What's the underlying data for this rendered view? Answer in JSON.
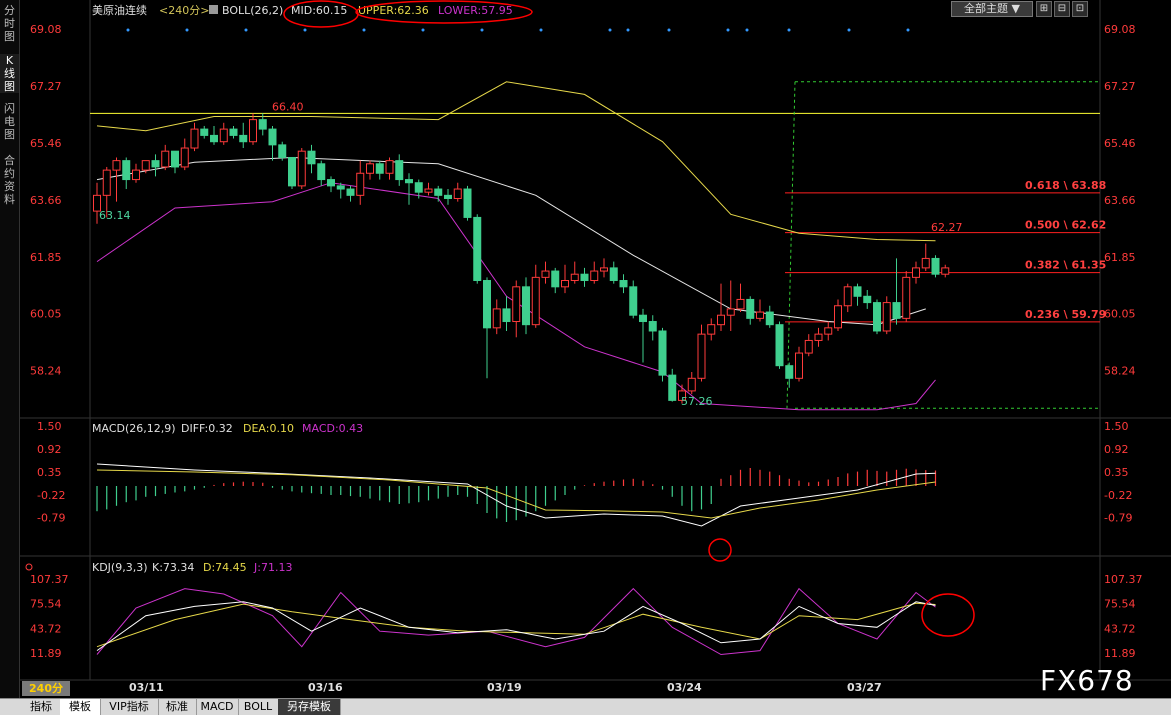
{
  "sidebar": {
    "tabs": [
      {
        "label": "分时图",
        "active": false
      },
      {
        "label": "K线图",
        "active": true
      },
      {
        "label": "闪电图",
        "active": false
      },
      {
        "label": "合约资料",
        "active": false
      }
    ]
  },
  "header": {
    "symbol": "美原油连续",
    "period": "<240分>",
    "boll_label": "BOLL(26,2)",
    "mid": "MID:60.15",
    "upper": "UPPER:62.36",
    "lower": "LOWER:57.95",
    "theme": "全部主题",
    "theme_icon": "dropdown-arrow-icon"
  },
  "price_axis": [
    "69.08",
    "67.27",
    "65.46",
    "63.66",
    "61.85",
    "60.05",
    "58.24"
  ],
  "annotations": {
    "level_line": "66.40",
    "low_left": "63.14",
    "low_mid": "57.26",
    "high_right": "62.27"
  },
  "fibonacci": [
    {
      "label": "0.618 \\ 63.88",
      "value": 63.88
    },
    {
      "label": "0.500 \\ 62.62",
      "value": 62.62
    },
    {
      "label": "0.382 \\ 61.35",
      "value": 61.35
    },
    {
      "label": "0.236 \\ 59.79",
      "value": 59.79
    }
  ],
  "macd": {
    "label": "MACD(26,12,9)",
    "diff": "DIFF:0.32",
    "dea": "DEA:0.10",
    "value": "MACD:0.43",
    "axis": [
      "1.50",
      "0.92",
      "0.35",
      "-0.22",
      "-0.79"
    ]
  },
  "kdj": {
    "label": "KDJ(9,3,3)",
    "k": "K:73.34",
    "d": "D:74.45",
    "j": "J:71.13",
    "axis": [
      "107.37",
      "75.54",
      "43.72",
      "11.89"
    ]
  },
  "x_axis": [
    "03/11",
    "03/16",
    "03/19",
    "03/24",
    "03/27"
  ],
  "period_badge": "240分",
  "bottom_tabs": [
    "指标",
    "模板",
    "VIP指标",
    "标准",
    "MACD",
    "BOLL",
    "另存模板"
  ],
  "watermark": "FX678",
  "colors": {
    "up": "#ff3b3b",
    "down": "#3fcf8e",
    "boll_mid": "#e6e6e6",
    "boll_upper": "#e6d84a",
    "boll_lower": "#cc33cc",
    "fib": "#ff2020",
    "highlight": "#ff0000"
  },
  "chart_data": {
    "type": "candlestick",
    "candles": [
      [
        63.3,
        63.8,
        64.2,
        62.9
      ],
      [
        63.8,
        64.6,
        64.7,
        63.1
      ],
      [
        64.6,
        64.9,
        65.0,
        63.6
      ],
      [
        64.9,
        64.3,
        65.0,
        64.0
      ],
      [
        64.3,
        64.6,
        64.8,
        64.2
      ],
      [
        64.6,
        64.9,
        64.9,
        64.5
      ],
      [
        64.9,
        64.7,
        65.1,
        64.4
      ],
      [
        64.7,
        65.2,
        65.4,
        64.6
      ],
      [
        65.2,
        64.7,
        65.2,
        64.5
      ],
      [
        64.7,
        65.3,
        65.6,
        64.6
      ],
      [
        65.3,
        65.9,
        66.1,
        65.2
      ],
      [
        65.9,
        65.7,
        66.0,
        65.6
      ],
      [
        65.7,
        65.5,
        66.0,
        65.4
      ],
      [
        65.5,
        65.9,
        66.1,
        65.4
      ],
      [
        65.9,
        65.7,
        66.0,
        65.6
      ],
      [
        65.7,
        65.5,
        66.1,
        65.3
      ],
      [
        65.5,
        66.2,
        66.4,
        65.4
      ],
      [
        66.2,
        65.9,
        66.4,
        65.7
      ],
      [
        65.9,
        65.4,
        66.0,
        64.9
      ],
      [
        65.4,
        65.0,
        65.5,
        64.9
      ],
      [
        65.0,
        64.1,
        65.0,
        64.0
      ],
      [
        64.1,
        65.2,
        65.3,
        64.0
      ],
      [
        65.2,
        64.8,
        65.4,
        64.5
      ],
      [
        64.8,
        64.3,
        64.9,
        64.1
      ],
      [
        64.3,
        64.1,
        64.4,
        63.9
      ],
      [
        64.1,
        64.0,
        64.2,
        63.7
      ],
      [
        64.0,
        63.8,
        64.1,
        63.6
      ],
      [
        63.8,
        64.5,
        64.9,
        63.5
      ],
      [
        64.5,
        64.8,
        64.9,
        64.3
      ],
      [
        64.8,
        64.5,
        64.9,
        64.3
      ],
      [
        64.5,
        64.9,
        65.0,
        64.3
      ],
      [
        64.9,
        64.3,
        65.1,
        64.1
      ],
      [
        64.3,
        64.2,
        64.5,
        63.5
      ],
      [
        64.2,
        63.9,
        64.3,
        63.7
      ],
      [
        63.9,
        64.0,
        64.2,
        63.8
      ],
      [
        64.0,
        63.8,
        64.1,
        63.6
      ],
      [
        63.8,
        63.7,
        64.0,
        63.5
      ],
      [
        63.7,
        64.0,
        64.2,
        63.6
      ],
      [
        64.0,
        63.1,
        64.1,
        63.0
      ],
      [
        63.1,
        61.1,
        63.2,
        61.0
      ],
      [
        61.1,
        59.6,
        61.2,
        58.0
      ],
      [
        59.6,
        60.2,
        60.5,
        59.4
      ],
      [
        60.2,
        59.8,
        60.6,
        59.5
      ],
      [
        59.8,
        60.9,
        61.1,
        59.3
      ],
      [
        60.9,
        59.7,
        61.2,
        59.4
      ],
      [
        59.7,
        61.2,
        61.6,
        59.6
      ],
      [
        61.2,
        61.4,
        61.7,
        61.0
      ],
      [
        61.4,
        60.9,
        61.5,
        60.7
      ],
      [
        60.9,
        61.1,
        61.6,
        60.7
      ],
      [
        61.1,
        61.3,
        61.7,
        61.0
      ],
      [
        61.3,
        61.1,
        61.5,
        60.9
      ],
      [
        61.1,
        61.4,
        61.7,
        61.0
      ],
      [
        61.4,
        61.5,
        61.8,
        61.2
      ],
      [
        61.5,
        61.1,
        61.7,
        61.0
      ],
      [
        61.1,
        60.9,
        61.3,
        60.7
      ],
      [
        60.9,
        60.0,
        61.1,
        59.9
      ],
      [
        60.0,
        59.8,
        60.2,
        58.5
      ],
      [
        59.8,
        59.5,
        60.0,
        59.2
      ],
      [
        59.5,
        58.1,
        59.6,
        57.9
      ],
      [
        58.1,
        57.3,
        58.3,
        57.26
      ],
      [
        57.3,
        57.6,
        57.8,
        57.2
      ],
      [
        57.6,
        58.0,
        58.2,
        57.5
      ],
      [
        58.0,
        59.4,
        59.7,
        57.9
      ],
      [
        59.4,
        59.7,
        59.9,
        59.2
      ],
      [
        59.7,
        60.0,
        61.0,
        59.5
      ],
      [
        60.0,
        60.2,
        61.1,
        59.5
      ],
      [
        60.2,
        60.5,
        61.0,
        60.1
      ],
      [
        60.5,
        59.9,
        60.6,
        59.7
      ],
      [
        59.9,
        60.1,
        60.5,
        59.8
      ],
      [
        60.1,
        59.7,
        60.3,
        59.6
      ],
      [
        59.7,
        58.4,
        59.8,
        58.3
      ],
      [
        58.4,
        58.0,
        58.5,
        57.7
      ],
      [
        58.0,
        58.8,
        59.0,
        57.9
      ],
      [
        58.8,
        59.2,
        59.4,
        58.7
      ],
      [
        59.2,
        59.4,
        59.6,
        59.0
      ],
      [
        59.4,
        59.6,
        59.8,
        59.2
      ],
      [
        59.6,
        60.3,
        60.5,
        59.5
      ],
      [
        60.3,
        60.9,
        61.0,
        60.1
      ],
      [
        60.9,
        60.6,
        61.0,
        60.3
      ],
      [
        60.6,
        60.4,
        60.8,
        60.2
      ],
      [
        60.4,
        59.5,
        60.5,
        59.4
      ],
      [
        59.5,
        60.4,
        60.6,
        59.4
      ],
      [
        60.4,
        59.9,
        61.8,
        59.7
      ],
      [
        59.9,
        61.2,
        61.4,
        59.8
      ],
      [
        61.2,
        61.5,
        61.7,
        61.0
      ],
      [
        61.5,
        61.8,
        62.27,
        61.4
      ],
      [
        61.8,
        61.3,
        61.9,
        61.2
      ],
      [
        61.3,
        61.5,
        61.6,
        61.2
      ]
    ],
    "boll_mid": [
      [
        0,
        64.3
      ],
      [
        10,
        64.85
      ],
      [
        20,
        65.0
      ],
      [
        35,
        64.8
      ],
      [
        45,
        63.8
      ],
      [
        55,
        61.9
      ],
      [
        65,
        60.2
      ],
      [
        75,
        59.8
      ],
      [
        80,
        59.7
      ],
      [
        85,
        60.2
      ]
    ],
    "boll_upper": [
      [
        0,
        66.0
      ],
      [
        5,
        65.85
      ],
      [
        12,
        66.3
      ],
      [
        22,
        66.3
      ],
      [
        35,
        66.2
      ],
      [
        42,
        67.4
      ],
      [
        50,
        67.0
      ],
      [
        58,
        65.5
      ],
      [
        65,
        63.2
      ],
      [
        72,
        62.6
      ],
      [
        80,
        62.4
      ],
      [
        86,
        62.36
      ]
    ],
    "boll_lower": [
      [
        0,
        61.7
      ],
      [
        8,
        63.4
      ],
      [
        18,
        63.6
      ],
      [
        24,
        64.2
      ],
      [
        35,
        63.7
      ],
      [
        42,
        60.6
      ],
      [
        50,
        59.0
      ],
      [
        58,
        58.2
      ],
      [
        62,
        57.2
      ],
      [
        72,
        57.0
      ],
      [
        80,
        57.0
      ],
      [
        84,
        57.2
      ],
      [
        86,
        57.95
      ]
    ],
    "macd_hist": [
      -0.7,
      -0.65,
      -0.55,
      -0.45,
      -0.4,
      -0.3,
      -0.28,
      -0.22,
      -0.18,
      -0.15,
      -0.1,
      -0.05,
      0.03,
      0.08,
      0.1,
      0.12,
      0.11,
      0.09,
      -0.05,
      -0.1,
      -0.15,
      -0.18,
      -0.2,
      -0.22,
      -0.25,
      -0.25,
      -0.28,
      -0.3,
      -0.35,
      -0.4,
      -0.45,
      -0.5,
      -0.48,
      -0.45,
      -0.4,
      -0.35,
      -0.3,
      -0.25,
      -0.3,
      -0.5,
      -0.75,
      -0.9,
      -1.0,
      -0.95,
      -0.85,
      -0.7,
      -0.55,
      -0.4,
      -0.25,
      -0.1,
      0.02,
      0.08,
      0.12,
      0.15,
      0.18,
      0.2,
      0.15,
      0.05,
      -0.1,
      -0.3,
      -0.55,
      -0.7,
      -0.65,
      -0.5,
      0.2,
      0.3,
      0.45,
      0.5,
      0.45,
      0.4,
      0.3,
      0.2,
      0.15,
      0.1,
      0.12,
      0.18,
      0.25,
      0.35,
      0.4,
      0.45,
      0.42,
      0.4,
      0.45,
      0.48,
      0.46,
      0.44,
      0.43
    ],
    "kdj_k": [
      [
        0,
        15
      ],
      [
        5,
        60
      ],
      [
        10,
        72
      ],
      [
        15,
        78
      ],
      [
        18,
        70
      ],
      [
        22,
        40
      ],
      [
        27,
        70
      ],
      [
        32,
        45
      ],
      [
        37,
        38
      ],
      [
        42,
        42
      ],
      [
        47,
        30
      ],
      [
        52,
        40
      ],
      [
        56,
        72
      ],
      [
        60,
        50
      ],
      [
        64,
        25
      ],
      [
        68,
        30
      ],
      [
        72,
        72
      ],
      [
        76,
        50
      ],
      [
        80,
        45
      ],
      [
        84,
        78
      ],
      [
        86,
        73.34
      ]
    ],
    "kdj_d": [
      [
        0,
        20
      ],
      [
        8,
        55
      ],
      [
        15,
        75
      ],
      [
        20,
        65
      ],
      [
        26,
        55
      ],
      [
        32,
        45
      ],
      [
        38,
        40
      ],
      [
        44,
        38
      ],
      [
        50,
        36
      ],
      [
        56,
        62
      ],
      [
        62,
        45
      ],
      [
        68,
        30
      ],
      [
        72,
        60
      ],
      [
        78,
        55
      ],
      [
        84,
        76
      ],
      [
        86,
        74.45
      ]
    ],
    "kdj_j": [
      [
        0,
        10
      ],
      [
        4,
        70
      ],
      [
        9,
        95
      ],
      [
        13,
        88
      ],
      [
        18,
        60
      ],
      [
        21,
        20
      ],
      [
        25,
        90
      ],
      [
        29,
        40
      ],
      [
        34,
        35
      ],
      [
        40,
        40
      ],
      [
        46,
        20
      ],
      [
        50,
        32
      ],
      [
        55,
        95
      ],
      [
        59,
        45
      ],
      [
        64,
        10
      ],
      [
        68,
        15
      ],
      [
        72,
        95
      ],
      [
        76,
        50
      ],
      [
        80,
        30
      ],
      [
        84,
        90
      ],
      [
        86,
        71.13
      ]
    ],
    "x_ticks": [
      [
        "03/11",
        3
      ],
      [
        "03/16",
        16
      ],
      [
        "03/19",
        29
      ],
      [
        "03/24",
        42
      ],
      [
        "03/27",
        55
      ]
    ],
    "fib_range": [
      57.26,
      67.4
    ],
    "level": 66.4
  }
}
